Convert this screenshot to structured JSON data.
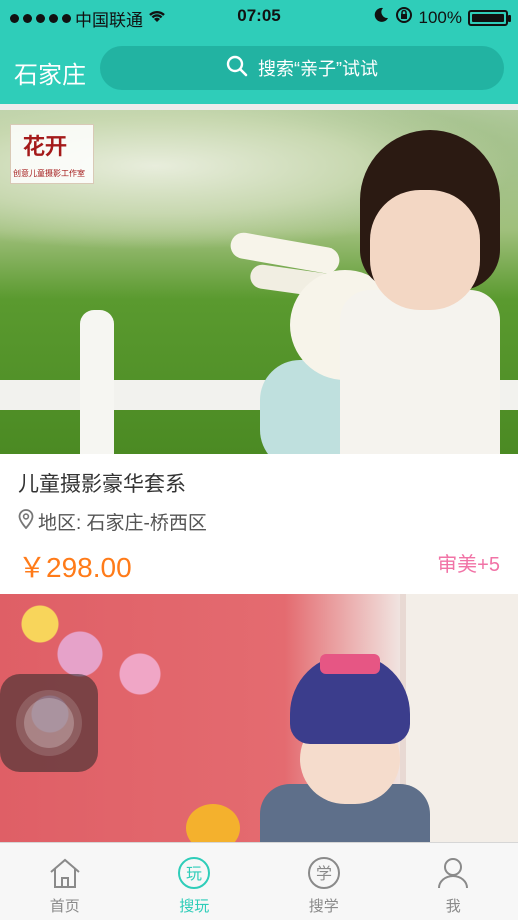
{
  "status_bar": {
    "carrier": "中国联通",
    "time": "07:05",
    "battery": "100%",
    "battery_fraction": 1.0
  },
  "header": {
    "city": "石家庄",
    "search_placeholder": "搜索“亲子”试试"
  },
  "listings": [
    {
      "logo_text": "花开",
      "logo_subtext": "创意儿童摄影工作室",
      "title": "儿童摄影豪华套系",
      "region": "地区: 石家庄-桥西区",
      "price": "￥298.00",
      "tag": "审美+5"
    }
  ],
  "tabs": [
    {
      "label": "首页",
      "icon": "house-icon",
      "active": false
    },
    {
      "label": "搜玩",
      "icon": "play-circle-icon",
      "glyph": "玩",
      "active": true
    },
    {
      "label": "搜学",
      "icon": "study-circle-icon",
      "glyph": "学",
      "active": false
    },
    {
      "label": "我",
      "icon": "user-icon",
      "active": false
    }
  ],
  "colors": {
    "accent": "#2fcdb9",
    "price": "#ff7b19",
    "tag": "#f173a6"
  }
}
